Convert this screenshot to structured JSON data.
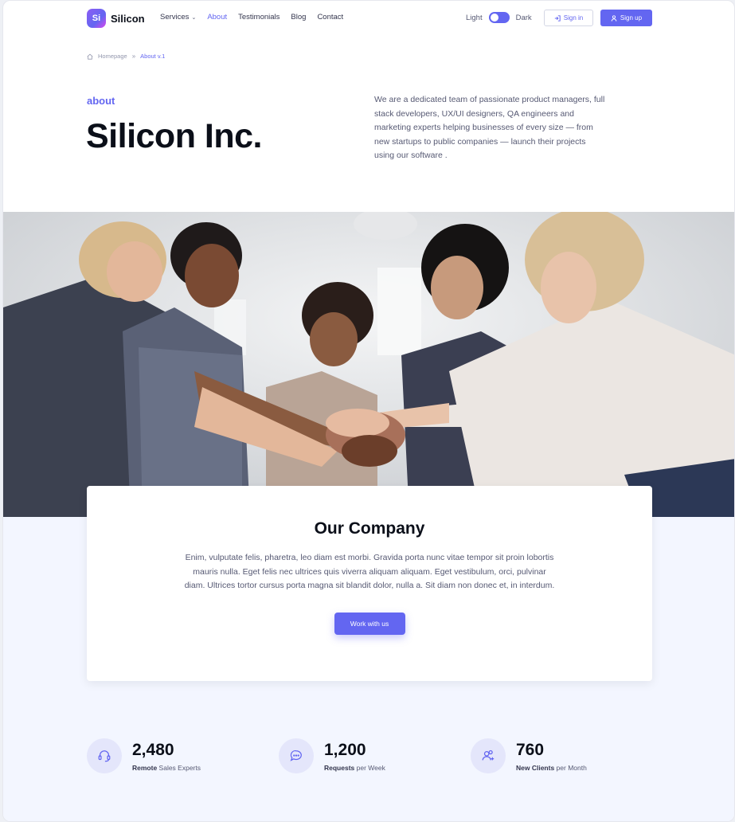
{
  "brand": {
    "mark": "Si",
    "name": "Silicon"
  },
  "nav": {
    "services": "Services",
    "about": "About",
    "testimonials": "Testimonials",
    "blog": "Blog",
    "contact": "Contact"
  },
  "mode": {
    "light": "Light",
    "dark": "Dark",
    "dark_enabled": true
  },
  "auth": {
    "signin": "Sign in",
    "signup": "Sign up"
  },
  "breadcrumb": {
    "home": "Homepage",
    "separator": "»",
    "current": "About v.1"
  },
  "hero": {
    "eyebrow": "about",
    "title": "Silicon Inc.",
    "lead": "We are a dedicated team of passionate product managers, full stack developers, UX/UI designers, QA engineers and marketing experts helping businesses of every size — from new startups to public companies — launch their projects using our software ."
  },
  "company": {
    "title": "Our Company",
    "text": "Enim, vulputate felis, pharetra, leo diam est morbi. Gravida porta nunc vitae tempor sit proin lobortis mauris nulla. Eget felis nec ultrices quis viverra aliquam aliquam. Eget vestibulum, orci, pulvinar diam. Ultrices tortor cursus porta magna sit blandit dolor, nulla a. Sit diam non donec et, in interdum.",
    "cta": "Work with us"
  },
  "stats": [
    {
      "icon": "headset-icon",
      "value": "2,480",
      "bold": "Remote",
      "rest": " Sales Experts"
    },
    {
      "icon": "chat-icon",
      "value": "1,200",
      "bold": "Requests",
      "rest": " per Week"
    },
    {
      "icon": "users-plus-icon",
      "value": "760",
      "bold": "New Clients",
      "rest": " per Month"
    }
  ],
  "colors": {
    "primary": "#6366f1",
    "heading": "#0b0f19",
    "body": "#565973",
    "section_bg": "#f3f6ff"
  }
}
